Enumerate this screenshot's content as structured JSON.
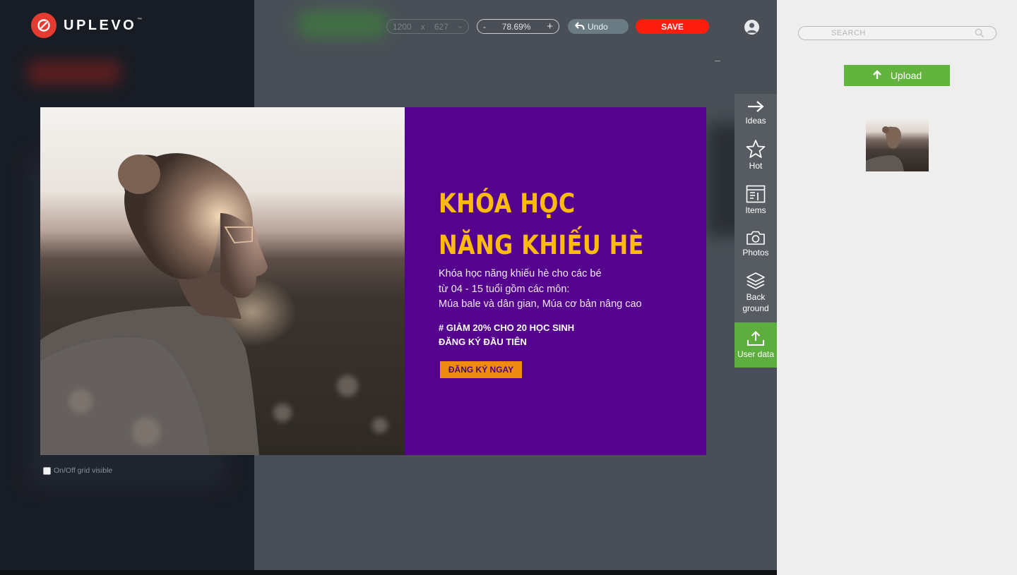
{
  "app": {
    "logo_text": "UPLEVO",
    "logo_tm": "™"
  },
  "toolbar": {
    "width": "1200",
    "size_separator": "x",
    "height": "627",
    "zoom_minus": "-",
    "zoom_value": "78.69%",
    "zoom_plus": "+",
    "undo_label": "Undo",
    "save_label": "SAVE"
  },
  "canvas": {
    "headline_line1": "KHÓA HỌC",
    "headline_line2": "NĂNG KHIẾU HÈ",
    "body_lines": [
      "Khóa học năng khiếu hè cho các bé",
      "từ 04 - 15 tuổi gồm các môn:",
      "Múa bale và dân gian, Múa cơ bản nâng cao"
    ],
    "promo_line1": "# GIẢM 20% CHO 20 HỌC SINH",
    "promo_line2": "ĐĂNG KÝ ĐẦU TIÊN",
    "cta_label": "ĐĂNG KÝ NGAY",
    "colors": {
      "panel": "#55028f",
      "headline": "#ffbb0c",
      "cta": "#f08b12"
    }
  },
  "grid_toggle": {
    "label": "On/Off grid visible",
    "checked": false
  },
  "side_tabs": [
    {
      "label": "Ideas",
      "icon": "arrow-right-icon"
    },
    {
      "label": "Hot",
      "icon": "star-icon"
    },
    {
      "label": "Items",
      "icon": "items-icon"
    },
    {
      "label": "Photos",
      "icon": "camera-icon"
    },
    {
      "label_line1": "Back",
      "label_line2": "ground",
      "icon": "layers-icon"
    },
    {
      "label": "User data",
      "icon": "upload-icon",
      "active": true
    }
  ],
  "right_panel": {
    "search_placeholder": "SEARCH",
    "upload_label": "Upload"
  }
}
